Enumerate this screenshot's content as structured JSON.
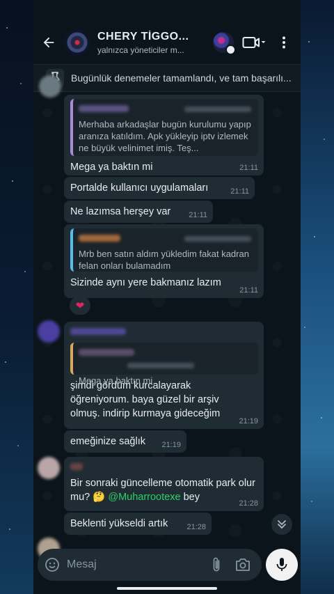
{
  "header": {
    "title": "CHERY TİGGO...",
    "subtitle": "yalnızca yöneticiler m..."
  },
  "pinned": {
    "text": "Bugünlük denemeler tamamlandı, ve tam başarılı..."
  },
  "messages": [
    {
      "quote_text": "Merhaba arkadaşlar bugün kurulumu yapıp aranıza katıldım. Apk yükleyip iptv izlemek ne büyük velinimet imiş. Teş...",
      "text": "Mega ya baktın mi",
      "time": "21:11"
    },
    {
      "text": "Portalde kullanıcı uygulamaları",
      "time": "21:11"
    },
    {
      "text": "Ne lazımsa herşey var",
      "time": "21:11"
    },
    {
      "quote_text": "Mrb ben satın aldım yükledim fakat kadran felan onları bulamadım",
      "text": "Sizinde aynı yere bakmanız lazım",
      "time": "21:11",
      "reaction": "❤"
    },
    {
      "quote_text": "Mega ya baktın mi",
      "text": "şimdi gördüm kurcalayarak öğreniyorum. baya güzel bir arşiv olmuş. indirip kurmaya gideceğim",
      "time": "21:19"
    },
    {
      "text": "emeğinize sağlık",
      "time": "21:19"
    },
    {
      "text_before": "Bir sonraki güncelleme otomatik park olur mu?",
      "emoji": "🤔",
      "mention": "@Muharrootexe",
      "text_after": "bey",
      "time": "21:28"
    },
    {
      "text": "Beklenti yükseldi artık",
      "time": "21:28"
    }
  ],
  "composer": {
    "placeholder": "Mesaj"
  },
  "icons": {
    "back": "arrow-left-icon",
    "video": "video-call-icon",
    "menu": "more-vertical-icon",
    "pin": "pin-icon",
    "emoji": "emoji-icon",
    "attach": "paperclip-icon",
    "camera": "camera-icon",
    "mic": "microphone-icon",
    "scroll": "chevron-double-down-icon"
  },
  "colors": {
    "background": "#0b141a",
    "bubble": "#202c33",
    "mention": "#25d366"
  }
}
